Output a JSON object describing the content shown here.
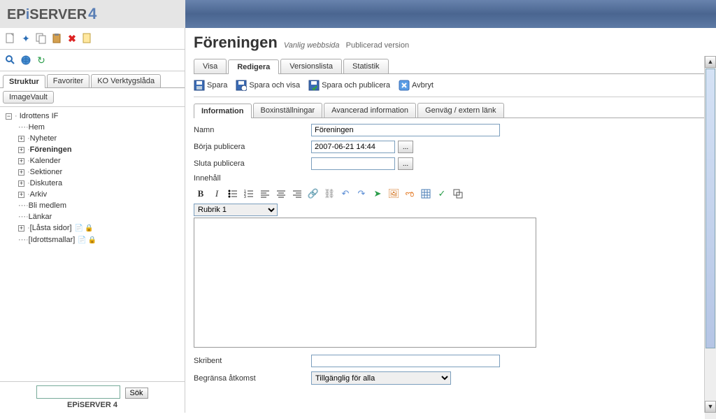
{
  "logo": {
    "ep": "EP",
    "i": "i",
    "server": "SERVER",
    "four": "4"
  },
  "sidebar": {
    "tabs": [
      {
        "label": "Struktur",
        "active": true
      },
      {
        "label": "Favoriter",
        "active": false
      },
      {
        "label": "KO Verktygslåda",
        "active": false
      }
    ],
    "subtab": "ImageVault",
    "tree": {
      "root": "Idrottens IF",
      "items": [
        {
          "label": "Hem",
          "expand": false
        },
        {
          "label": "Nyheter",
          "expand": true
        },
        {
          "label": "Föreningen",
          "expand": true,
          "bold": true
        },
        {
          "label": "Kalender",
          "expand": true
        },
        {
          "label": "Sektioner",
          "expand": true
        },
        {
          "label": "Diskutera",
          "expand": true
        },
        {
          "label": "Arkiv",
          "expand": true
        },
        {
          "label": "Bli medlem",
          "expand": false
        },
        {
          "label": "Länkar",
          "expand": false
        },
        {
          "label": "[Låsta sidor]",
          "expand": true,
          "icons": true
        },
        {
          "label": "[Idrottsmallar]",
          "expand": false,
          "icons": true
        }
      ]
    },
    "search_button": "Sök",
    "footer": "EPiSERVER 4"
  },
  "page": {
    "title": "Föreningen",
    "subtitle": "Vanlig webbsida",
    "status": "Publicerad version",
    "main_tabs": [
      {
        "label": "Visa"
      },
      {
        "label": "Redigera",
        "active": true
      },
      {
        "label": "Versionslista"
      },
      {
        "label": "Statistik"
      }
    ],
    "actions": {
      "save": "Spara",
      "save_view": "Spara och visa",
      "save_publish": "Spara och publicera",
      "cancel": "Avbryt"
    },
    "content_tabs": [
      {
        "label": "Information",
        "active": true
      },
      {
        "label": "Boxinställningar"
      },
      {
        "label": "Avancerad information"
      },
      {
        "label": "Genväg / extern länk"
      }
    ],
    "form": {
      "name_label": "Namn",
      "name_value": "Föreningen",
      "start_pub_label": "Börja publicera",
      "start_pub_value": "2007-06-21 14:44",
      "stop_pub_label": "Sluta publicera",
      "stop_pub_value": "",
      "content_label": "Innehåll",
      "heading_select": "Rubrik 1",
      "author_label": "Skribent",
      "author_value": "",
      "access_label": "Begränsa åtkomst",
      "access_value": "Tillgänglig för alla"
    },
    "date_btn": "..."
  }
}
